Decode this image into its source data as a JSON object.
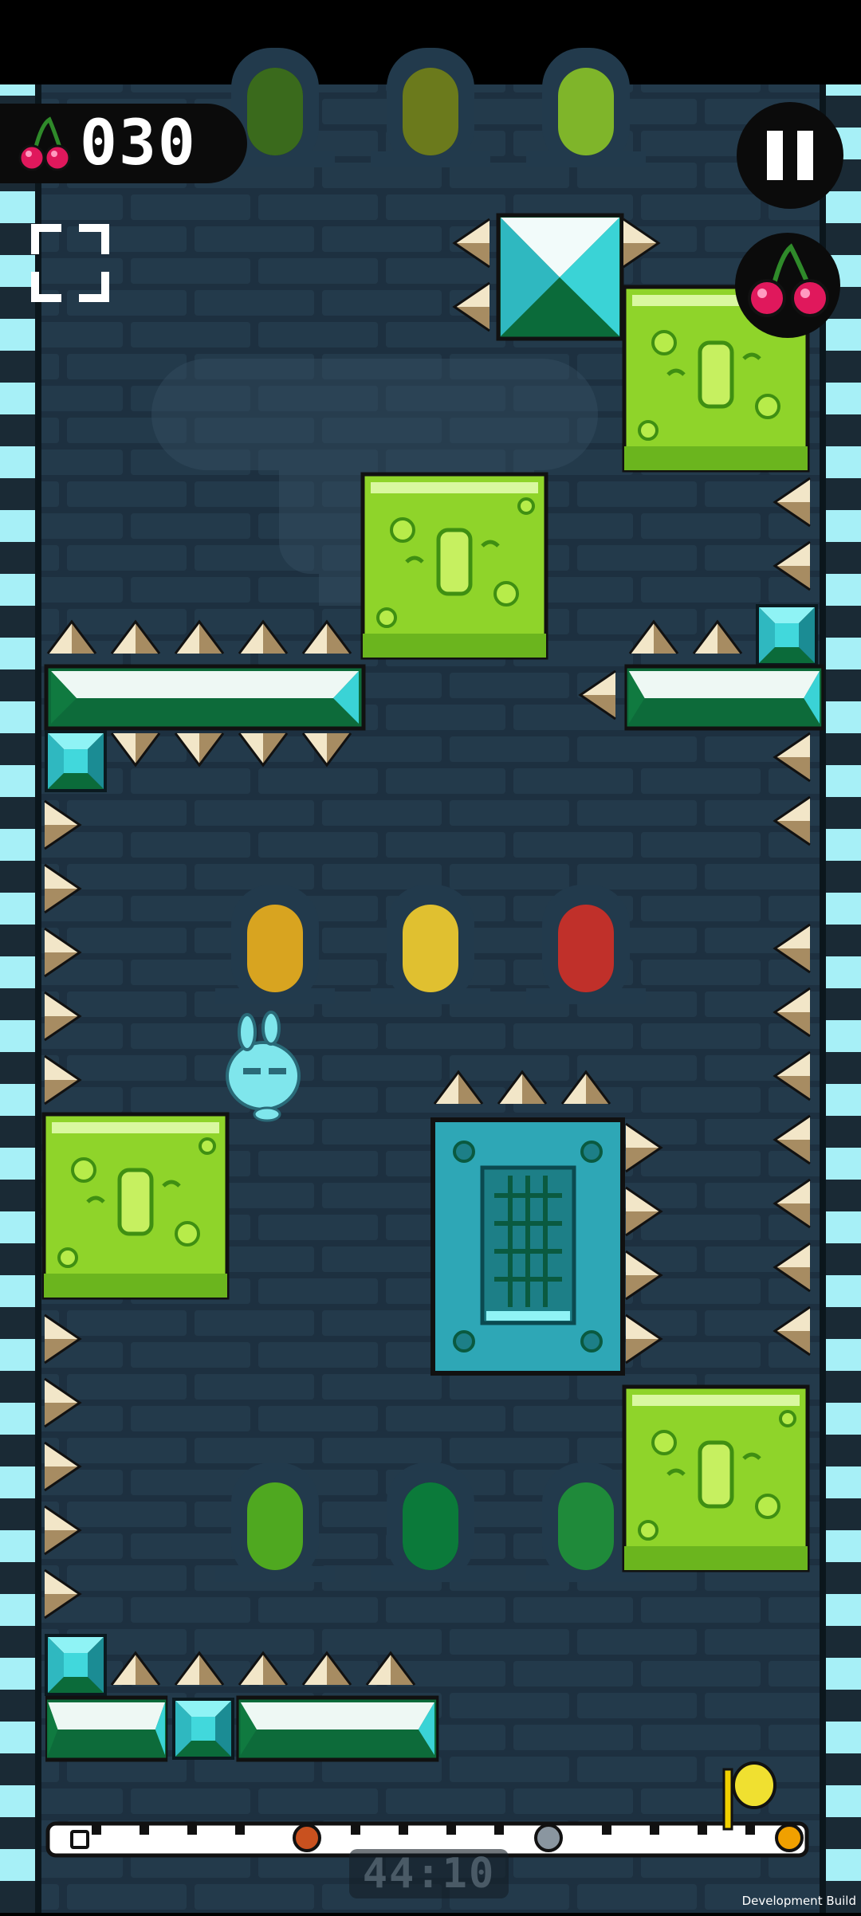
{
  "hud": {
    "cherry_count": "030",
    "timer": "44:10",
    "build_label": "Development Build"
  },
  "icons": {
    "cherry": "cherry-icon",
    "fullscreen": "fullscreen-icon",
    "pause": "pause-icon",
    "bonus_cherry": "cherry-icon",
    "goal": "flag-icon"
  },
  "progress": {
    "value": 0.02
  },
  "colors": {
    "background": "#1b2e3a",
    "brick": "#22394a",
    "slime": "#8fd42a",
    "slime_dark": "#3f8f12",
    "crystal": "#3ad3d6",
    "wall_stripe_a": "#a7f0f7",
    "wall_stripe_b": "#1b2b36",
    "spike_light": "#f2e6c8",
    "spike_dark": "#a78c62"
  }
}
